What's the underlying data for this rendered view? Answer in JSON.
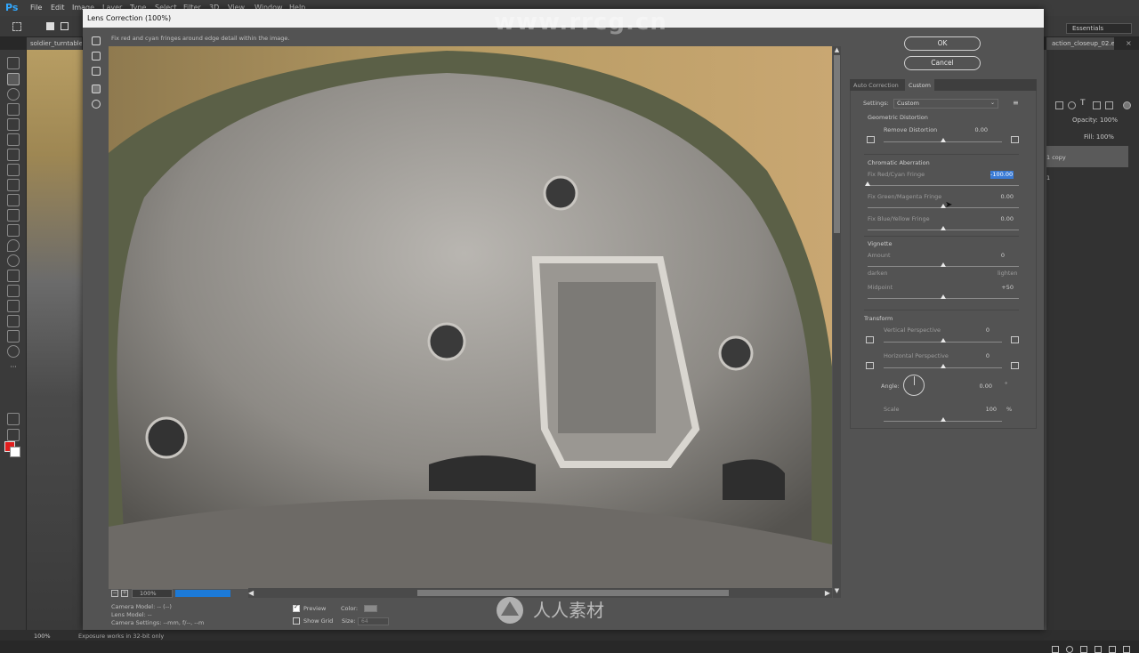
{
  "app": {
    "logo": "Ps",
    "menus": [
      "File",
      "Edit",
      "Image",
      "Layer",
      "Type",
      "Select",
      "Filter",
      "3D",
      "View",
      "Window",
      "Help"
    ],
    "workspace": "Essentials",
    "doc_tab_left": "soldier_turntable",
    "doc_tab_right": "action_closeup_02.e",
    "doc_tab_close": "×",
    "status": {
      "zoom": "100%",
      "info": "Exposure works in 32-bit only"
    },
    "layers_panel": {
      "opacity_label": "Opacity: 100%",
      "fill_label": "Fill: 100%",
      "layer_copy": "1 copy",
      "layer_1": "1"
    }
  },
  "dialog": {
    "title": "Lens Correction (100%)",
    "hint": "Fix red and cyan fringes around edge detail within the image.",
    "buttons": {
      "ok": "OK",
      "cancel": "Cancel"
    },
    "tabs": [
      "Auto Correction",
      "Custom"
    ],
    "active_tab": "Custom",
    "settings": {
      "label": "Settings:",
      "value": "Custom"
    },
    "geometric": {
      "heading": "Geometric Distortion",
      "remove_distortion": {
        "label": "Remove Distortion",
        "value": "0.00",
        "level": 0.5
      }
    },
    "chromatic": {
      "heading": "Chromatic Aberration",
      "red_cyan": {
        "label": "Fix Red/Cyan Fringe",
        "value": "-100.00",
        "level": 0.0
      },
      "green_magenta": {
        "label": "Fix Green/Magenta Fringe",
        "value": "0.00",
        "level": 0.5
      },
      "blue_yellow": {
        "label": "Fix Blue/Yellow Fringe",
        "value": "0.00",
        "level": 0.5
      }
    },
    "vignette": {
      "heading": "Vignette",
      "amount": {
        "label": "Amount",
        "value": "0",
        "level": 0.5
      },
      "darken": "darken",
      "lighten": "lighten",
      "midpoint": {
        "label": "Midpoint",
        "value": "+50",
        "level": 0.5
      }
    },
    "transform": {
      "heading": "Transform",
      "vertical": {
        "label": "Vertical Perspective",
        "value": "0",
        "level": 0.5
      },
      "horizontal": {
        "label": "Horizontal Perspective",
        "value": "0",
        "level": 0.5
      },
      "angle": {
        "label": "Angle:",
        "value": "0.00",
        "unit": "°"
      },
      "scale": {
        "label": "Scale",
        "value": "100",
        "unit": "%",
        "level": 0.5
      }
    },
    "bottom": {
      "zoom": "100%",
      "zoom_minus": "−",
      "zoom_plus": "+",
      "progress": 1.0,
      "camera_model": "Camera Model: -- (--)",
      "lens_model": "Lens Model: --",
      "camera_settings": "Camera Settings: --mm, f/--, --m",
      "preview_label": "Preview",
      "show_grid_label": "Show Grid",
      "color_label": "Color:",
      "size_label": "Size:",
      "size_value": "64"
    }
  },
  "overlay": {
    "watermark_top": "www.rrcg.cn",
    "watermark_bottom": "人人素材"
  },
  "colors": {
    "accent_blue": "#1c7ad8",
    "selection_blue": "#3a7bd5",
    "foreground_color": "#e11d1d",
    "background_color": "#ffffff"
  }
}
